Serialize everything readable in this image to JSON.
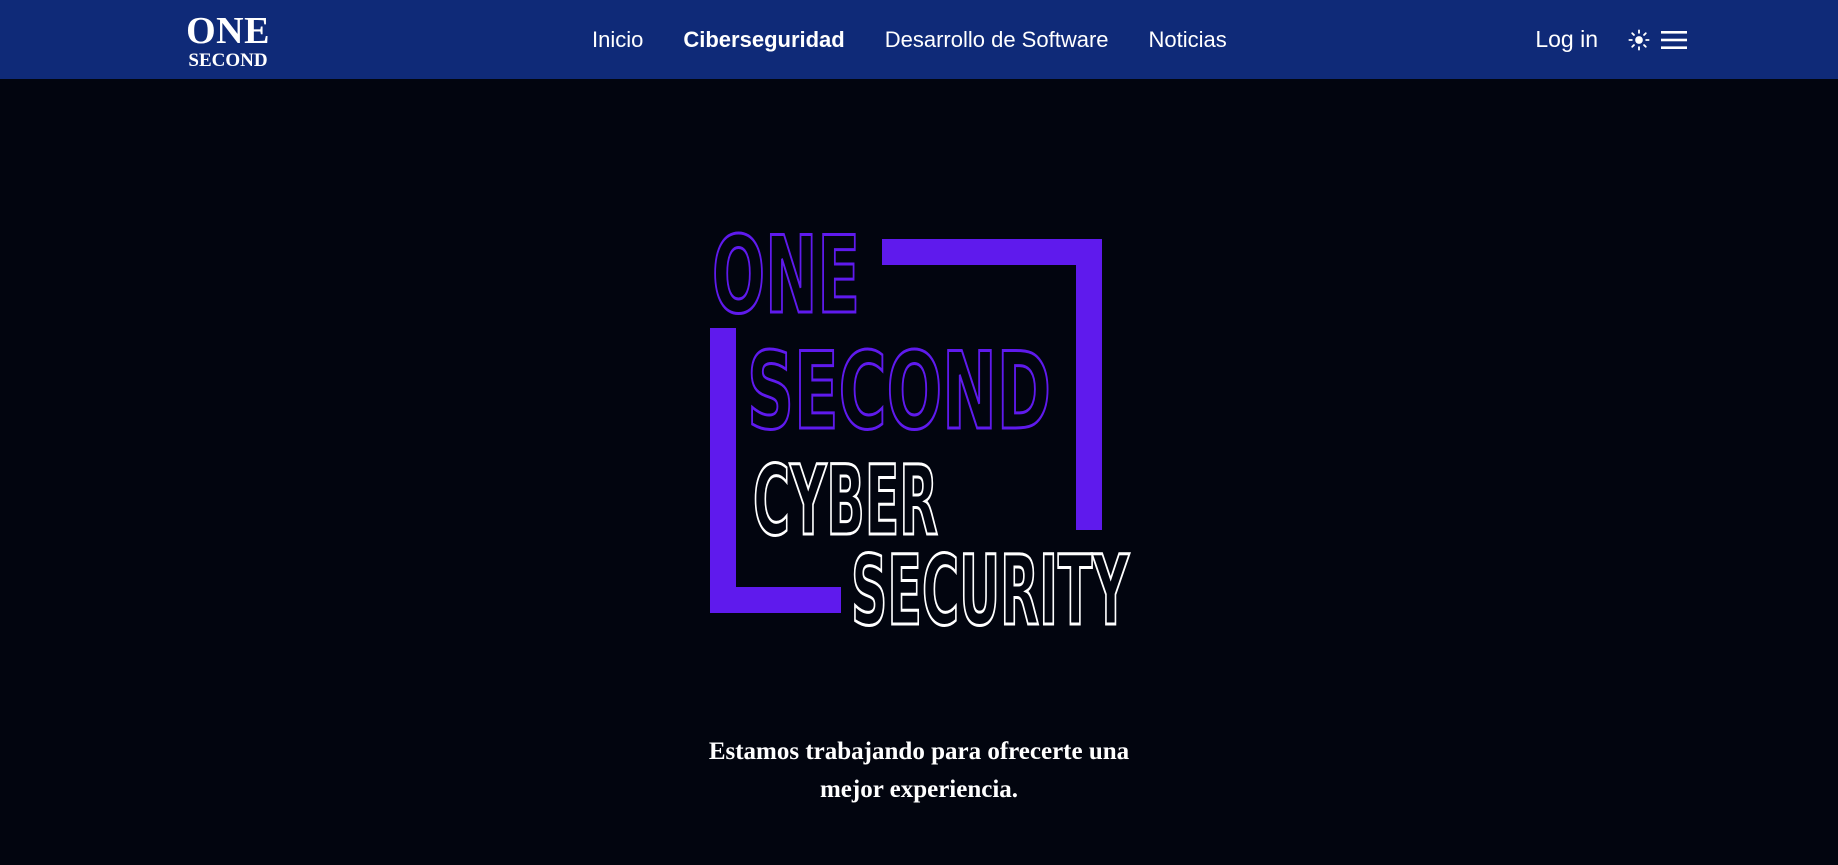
{
  "brand": {
    "line1": "ONE",
    "line2": "SECOND"
  },
  "nav": {
    "items": [
      {
        "label": "Inicio",
        "active": false
      },
      {
        "label": "Ciberseguridad",
        "active": true
      },
      {
        "label": "Desarrollo de Software",
        "active": false
      },
      {
        "label": "Noticias",
        "active": false
      }
    ],
    "login_label": "Log in",
    "theme_icon": "sun-icon",
    "menu_icon": "hamburger-menu-icon"
  },
  "hero": {
    "logo": {
      "line1": "ONE",
      "line2": "SECOND",
      "line3": "CYBER",
      "line4": "SECURITY"
    },
    "message_line1": "Estamos trabajando para ofrecerte una",
    "message_line2": "mejor experiencia."
  },
  "colors": {
    "navbar": "#0f2a78",
    "background": "#02050f",
    "accent_purple": "#5f1aed",
    "text": "#ffffff"
  }
}
